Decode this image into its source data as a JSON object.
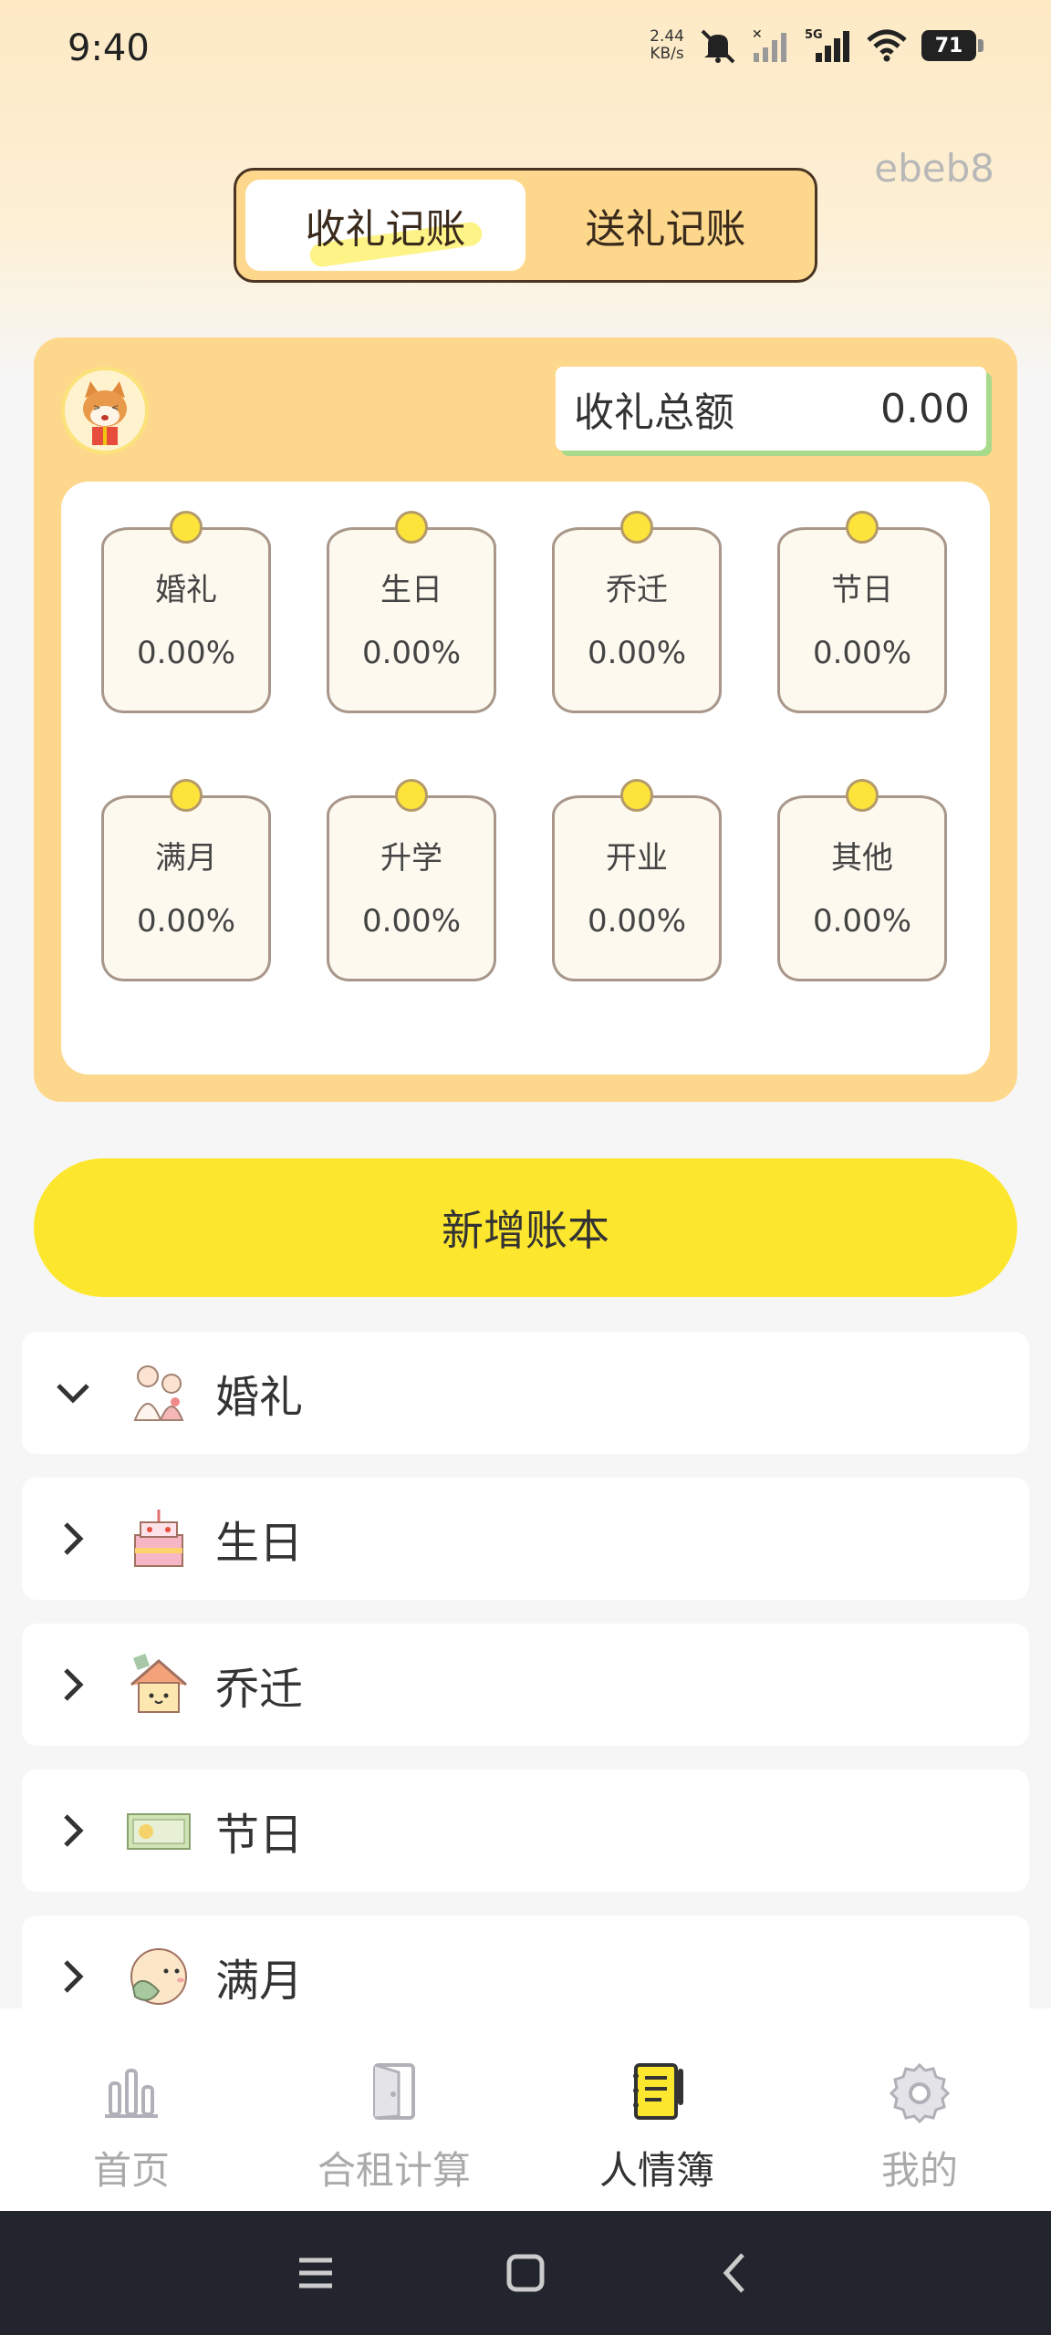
{
  "status": {
    "time": "9:40",
    "net_speed_value": "2.44",
    "net_speed_unit": "KB/s",
    "network": "5G",
    "battery": "71"
  },
  "header": {
    "tabs": [
      {
        "label": "收礼记账",
        "active": true
      },
      {
        "label": "送礼记账",
        "active": false
      }
    ],
    "user_tag": "ebeb8"
  },
  "summary": {
    "total_label": "收礼总额",
    "total_value": "0.00",
    "categories": [
      {
        "name": "婚礼",
        "percent": "0.00%"
      },
      {
        "name": "生日",
        "percent": "0.00%"
      },
      {
        "name": "乔迁",
        "percent": "0.00%"
      },
      {
        "name": "节日",
        "percent": "0.00%"
      },
      {
        "name": "满月",
        "percent": "0.00%"
      },
      {
        "name": "升学",
        "percent": "0.00%"
      },
      {
        "name": "开业",
        "percent": "0.00%"
      },
      {
        "name": "其他",
        "percent": "0.00%"
      }
    ]
  },
  "add_button": {
    "label": "新增账本"
  },
  "ledger_list": [
    {
      "label": "婚礼",
      "expanded": true,
      "icon": "wedding-couple-icon"
    },
    {
      "label": "生日",
      "expanded": false,
      "icon": "birthday-cake-icon"
    },
    {
      "label": "乔迁",
      "expanded": false,
      "icon": "house-icon"
    },
    {
      "label": "节日",
      "expanded": false,
      "icon": "festival-envelope-icon"
    },
    {
      "label": "满月",
      "expanded": false,
      "icon": "baby-face-icon"
    }
  ],
  "tabbar": [
    {
      "label": "首页",
      "icon": "bar-chart-icon",
      "active": false
    },
    {
      "label": "合租计算",
      "icon": "door-icon",
      "active": false
    },
    {
      "label": "人情簿",
      "icon": "notebook-icon",
      "active": true
    },
    {
      "label": "我的",
      "icon": "gear-icon",
      "active": false
    }
  ],
  "colors": {
    "accent_yellow": "#fde72e",
    "card_bg": "#fdd88c",
    "dark_outline": "#4a3424"
  }
}
